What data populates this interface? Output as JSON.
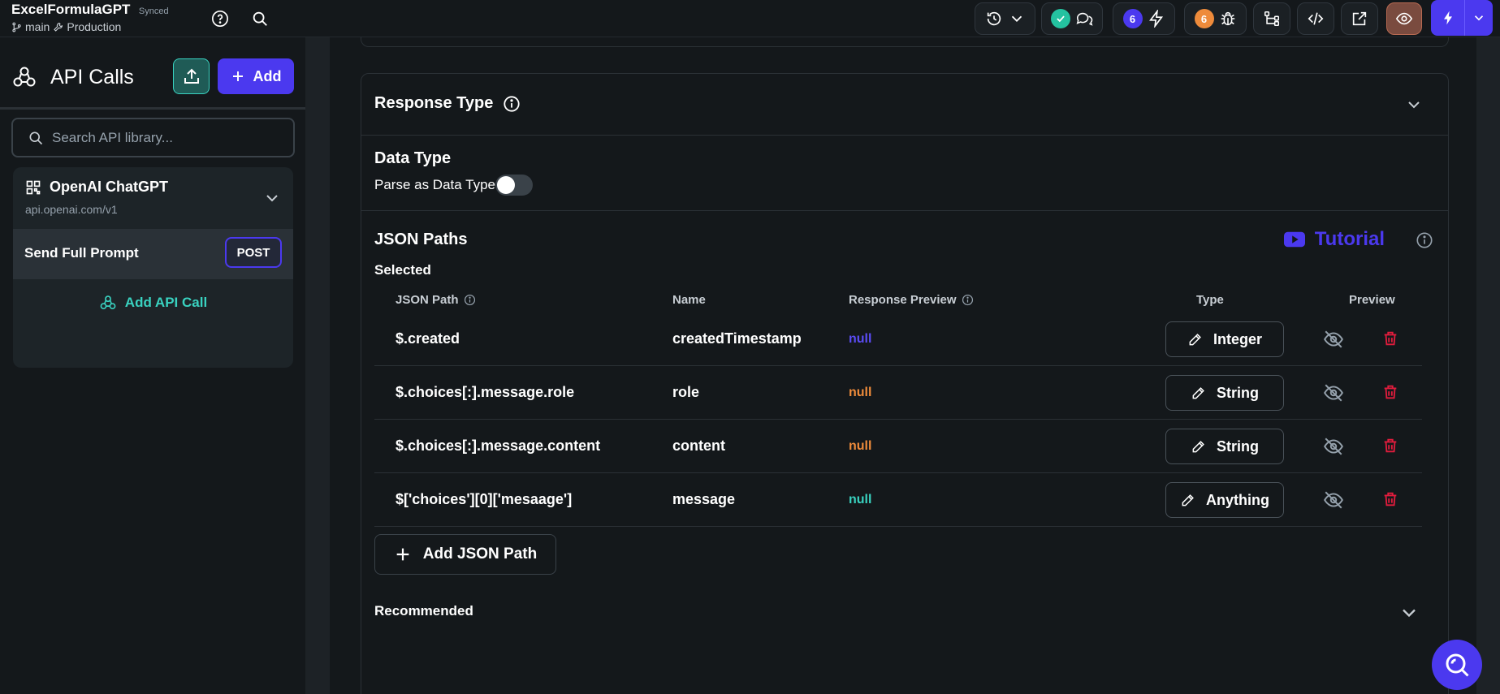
{
  "project": {
    "name": "ExcelFormulaGPT",
    "sync_status": "Synced",
    "branch": "main",
    "environment": "Production"
  },
  "toolbar": {
    "badge_warnings": "6",
    "badge_issues": "6"
  },
  "sidebar": {
    "title": "API Calls",
    "add_label": "Add",
    "search_placeholder": "Search API library...",
    "group": {
      "name": "OpenAI ChatGPT",
      "url": "api.openai.com/v1",
      "calls": [
        {
          "label": "Send Full Prompt",
          "method": "POST"
        }
      ],
      "add_call_label": "Add API Call"
    }
  },
  "main": {
    "response_type_label": "Response Type",
    "data_type_label": "Data Type",
    "parse_label": "Parse as Data Type",
    "parse_enabled": false,
    "json_paths_label": "JSON Paths",
    "tutorial_label": "Tutorial",
    "selected_label": "Selected",
    "columns": {
      "json_path": "JSON Path",
      "name": "Name",
      "response_preview": "Response Preview",
      "type": "Type",
      "preview": "Preview"
    },
    "rows": [
      {
        "path": "$.created",
        "name": "createdTimestamp",
        "preview": "null",
        "preview_color": "#5b4cf5",
        "type": "Integer"
      },
      {
        "path": "$.choices[:].message.role",
        "name": "role",
        "preview": "null",
        "preview_color": "#ee8b3b",
        "type": "String"
      },
      {
        "path": "$.choices[:].message.content",
        "name": "content",
        "preview": "null",
        "preview_color": "#ee8b3b",
        "type": "String"
      },
      {
        "path": "$['choices'][0]['mesaage']",
        "name": "message",
        "preview": "null",
        "preview_color": "#39d2c0",
        "type": "Anything"
      }
    ],
    "add_json_path_label": "Add JSON Path",
    "recommended_label": "Recommended"
  },
  "colors": {
    "accent": "#4b39ef",
    "teal": "#39d2c0",
    "orange": "#ee8b3b",
    "danger": "#e21c3d",
    "background": "#14181b"
  },
  "icons": [
    "help-icon",
    "search-icon",
    "history-icon",
    "chevron-down-icon",
    "check-icon",
    "comments-icon",
    "bolt-icon",
    "bug-icon",
    "branch-icon",
    "code-icon",
    "external-link-icon",
    "eye-icon",
    "api-icon",
    "upload-icon",
    "plus-icon",
    "grid-icon",
    "info-icon",
    "youtube-icon",
    "edit-icon",
    "eye-off-icon",
    "trash-icon",
    "search-fab-icon"
  ]
}
